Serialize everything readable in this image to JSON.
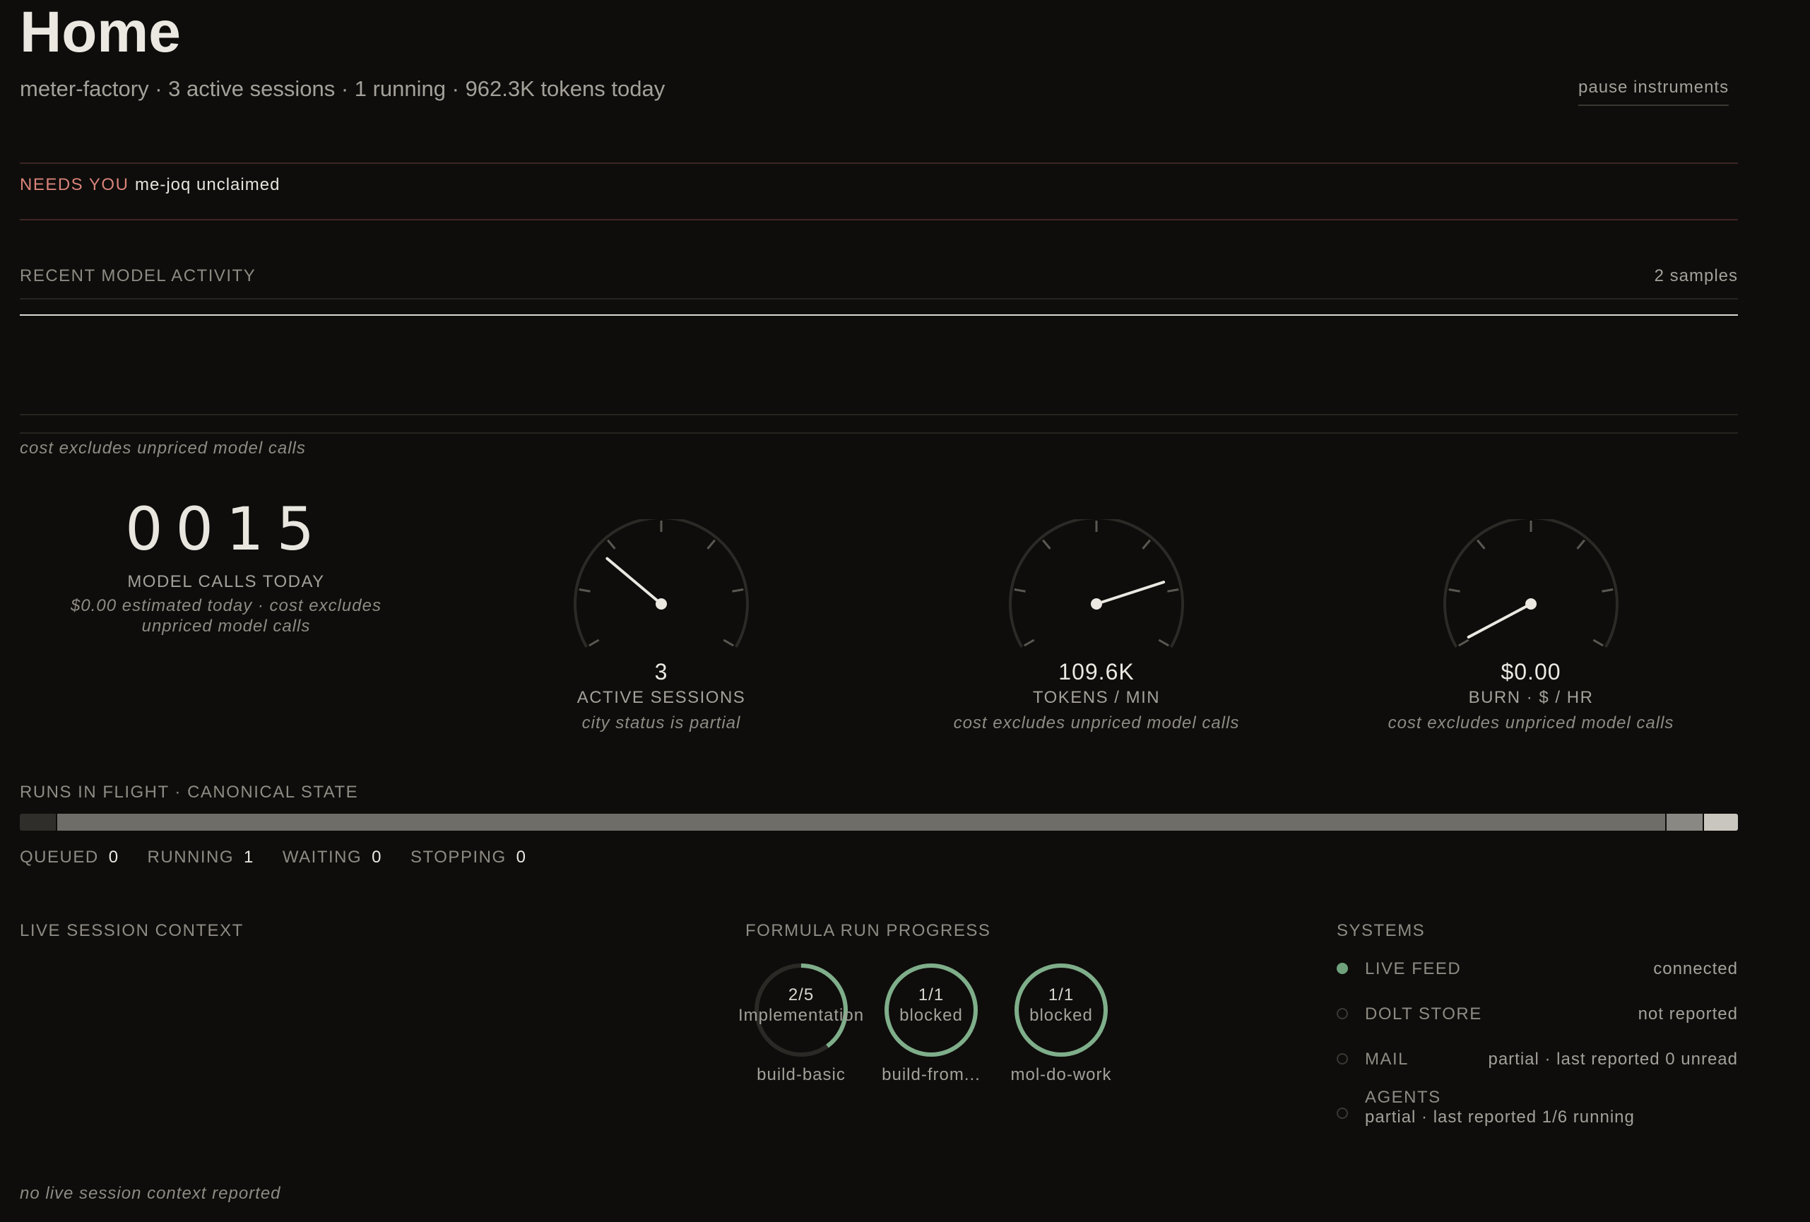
{
  "header": {
    "title": "Home",
    "subtitle": "meter-factory · 3 active sessions · 1 running · 962.3K tokens today",
    "pause_label": "pause instruments"
  },
  "needs_you": {
    "label": "NEEDS YOU",
    "value": "me-joq unclaimed"
  },
  "activity": {
    "title": "RECENT MODEL ACTIVITY",
    "samples": "2 samples",
    "note": "cost excludes unpriced model calls"
  },
  "counter": {
    "value": "0015",
    "label": "MODEL CALLS TODAY",
    "note": "$0.00 estimated today · cost excludes unpriced model calls"
  },
  "gauges": [
    {
      "value": "3",
      "label": "ACTIVE SESSIONS",
      "note": "city status is partial",
      "needle_angle_deg": -50
    },
    {
      "value": "109.6K",
      "label": "TOKENS / MIN",
      "note": "cost excludes unpriced model calls",
      "needle_angle_deg": 72
    },
    {
      "value": "$0.00",
      "label": "BURN · $ / HR",
      "note": "cost excludes unpriced model calls",
      "needle_angle_deg": -118
    }
  ],
  "runs": {
    "title": "RUNS IN FLIGHT · CANONICAL STATE",
    "segments": [
      {
        "fraction": 0.021,
        "color": "#2f2e2a"
      },
      {
        "fraction": 0.938,
        "color": "#6f6d67"
      },
      {
        "fraction": 0.021,
        "color": "#8a8882"
      },
      {
        "fraction": 0.02,
        "color": "#c9c6c0"
      }
    ],
    "legend": [
      {
        "label": "QUEUED",
        "count": "0"
      },
      {
        "label": "RUNNING",
        "count": "1"
      },
      {
        "label": "WAITING",
        "count": "0"
      },
      {
        "label": "STOPPING",
        "count": "0"
      }
    ]
  },
  "live_session": {
    "title": "LIVE SESSION CONTEXT",
    "note": "no live session context reported"
  },
  "formula": {
    "title": "FORMULA RUN PROGRESS",
    "rings": [
      {
        "top": "2/5",
        "bottom": "Implementation",
        "name": "build-basic",
        "progress": 0.4
      },
      {
        "top": "1/1",
        "bottom": "blocked",
        "name": "build-from...",
        "progress": 1.0
      },
      {
        "top": "1/1",
        "bottom": "blocked",
        "name": "mol-do-work",
        "progress": 1.0
      }
    ],
    "ring_color": "#7fae8a",
    "ring_track_color": "#2a2926"
  },
  "systems": {
    "title": "SYSTEMS",
    "items": [
      {
        "name": "LIVE FEED",
        "status": "connected",
        "state": "ok"
      },
      {
        "name": "DOLT STORE",
        "status": "not reported",
        "state": "none"
      },
      {
        "name": "MAIL",
        "status": "partial · last reported 0 unread",
        "state": "none"
      },
      {
        "name": "AGENTS",
        "status": "partial · last reported 1/6 running",
        "state": "none"
      }
    ],
    "ok_color": "#6fa27c"
  }
}
